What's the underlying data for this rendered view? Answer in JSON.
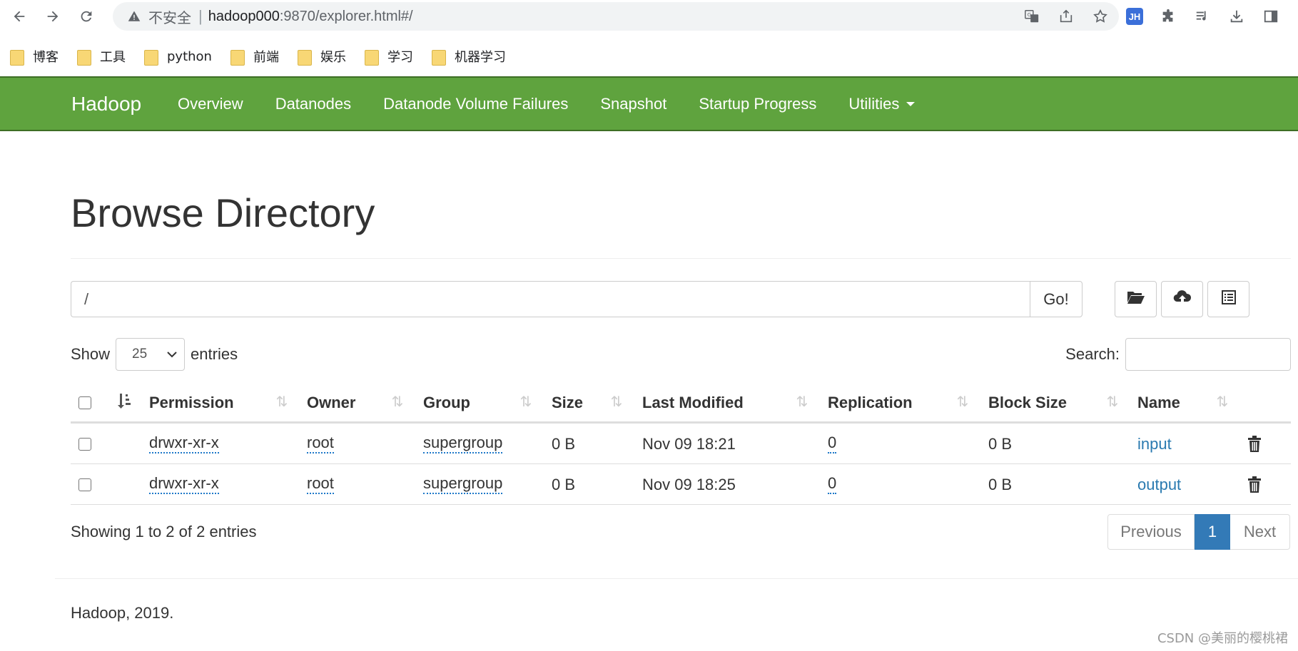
{
  "browser": {
    "security_label": "不安全",
    "url_host": "hadoop000",
    "url_rest": ":9870/explorer.html#/",
    "ext_badge": "JH",
    "bookmarks": [
      {
        "label": "博客"
      },
      {
        "label": "工具"
      },
      {
        "label": "python"
      },
      {
        "label": "前端"
      },
      {
        "label": "娱乐"
      },
      {
        "label": "学习"
      },
      {
        "label": "机器学习"
      }
    ]
  },
  "navbar": {
    "brand": "Hadoop",
    "items": [
      {
        "label": "Overview"
      },
      {
        "label": "Datanodes"
      },
      {
        "label": "Datanode Volume Failures"
      },
      {
        "label": "Snapshot"
      },
      {
        "label": "Startup Progress"
      },
      {
        "label": "Utilities"
      }
    ],
    "color": "#5fa33e"
  },
  "main": {
    "title": "Browse Directory",
    "path_value": "/",
    "go_label": "Go!",
    "show_label": "Show",
    "entries_value": "25",
    "entries_label": "entries",
    "search_label": "Search:",
    "search_value": ""
  },
  "table": {
    "headers": {
      "permission": "Permission",
      "owner": "Owner",
      "group": "Group",
      "size": "Size",
      "last_modified": "Last Modified",
      "replication": "Replication",
      "block_size": "Block Size",
      "name": "Name"
    },
    "rows": [
      {
        "permission": "drwxr-xr-x",
        "owner": "root",
        "group": "supergroup",
        "size": "0 B",
        "last_modified": "Nov 09 18:21",
        "replication": "0",
        "block_size": "0 B",
        "name": "input"
      },
      {
        "permission": "drwxr-xr-x",
        "owner": "root",
        "group": "supergroup",
        "size": "0 B",
        "last_modified": "Nov 09 18:25",
        "replication": "0",
        "block_size": "0 B",
        "name": "output"
      }
    ]
  },
  "pagination": {
    "info": "Showing 1 to 2 of 2 entries",
    "previous": "Previous",
    "current": "1",
    "next": "Next"
  },
  "footer": {
    "text": "Hadoop, 2019.",
    "watermark": "CSDN @美丽的樱桃裙"
  }
}
